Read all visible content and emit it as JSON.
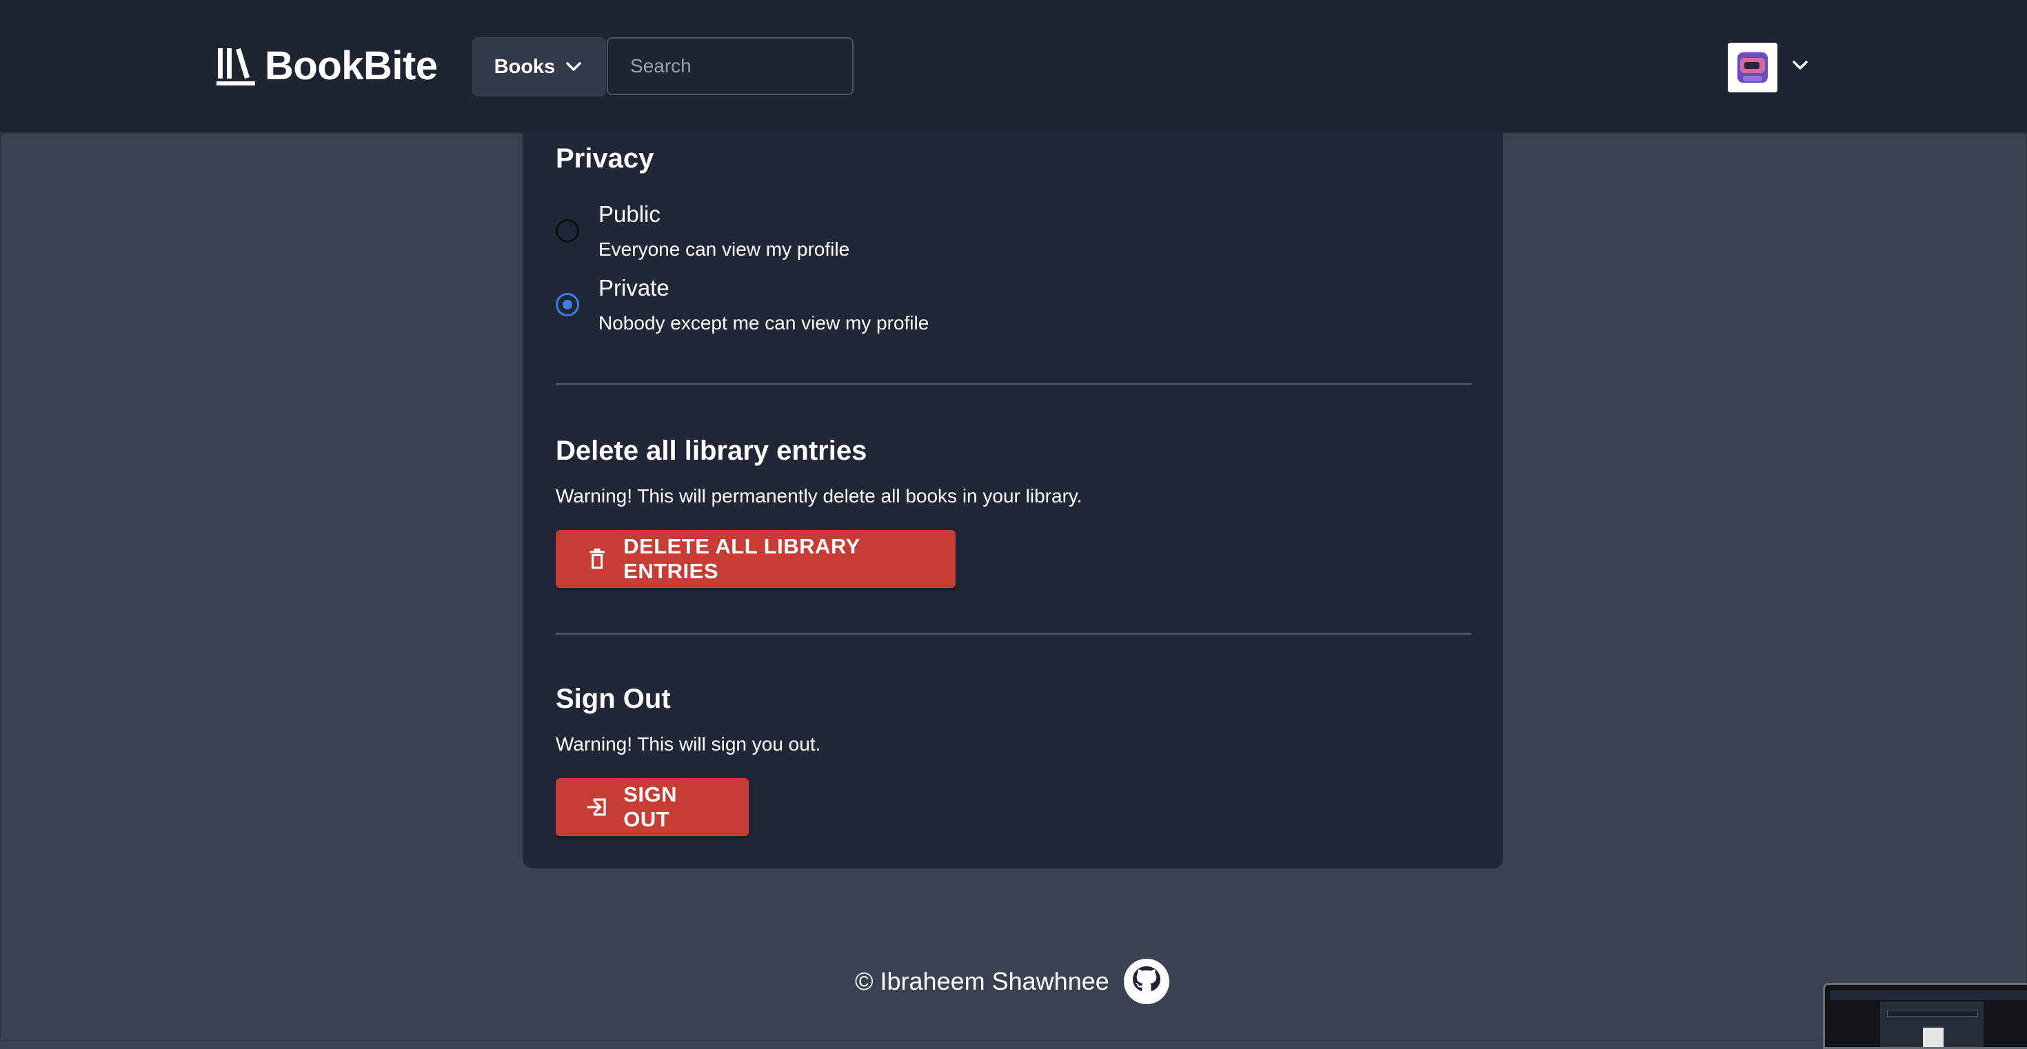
{
  "header": {
    "brand": "BookBite",
    "books_menu": "Books",
    "search_placeholder": "Search"
  },
  "privacy": {
    "title": "Privacy",
    "options": [
      {
        "label": "Public",
        "description": "Everyone can view my profile",
        "selected": false
      },
      {
        "label": "Private",
        "description": "Nobody except me can view my profile",
        "selected": true
      }
    ]
  },
  "delete_section": {
    "title": "Delete all library entries",
    "warning": "Warning! This will permanently delete all books in your library.",
    "button": "DELETE ALL LIBRARY ENTRIES"
  },
  "signout_section": {
    "title": "Sign Out",
    "warning": "Warning! This will sign you out.",
    "button": "SIGN OUT"
  },
  "footer": {
    "copyright": "© Ibraheem Shawhnee"
  },
  "colors": {
    "page_bg": "#3a4150",
    "header_bg": "#1e2431",
    "card_bg": "#212736",
    "danger": "#c73c35",
    "accent": "#3d7fe0"
  },
  "icons": [
    "library-icon",
    "chevron-down-icon",
    "trash-icon",
    "logout-icon",
    "github-icon"
  ]
}
